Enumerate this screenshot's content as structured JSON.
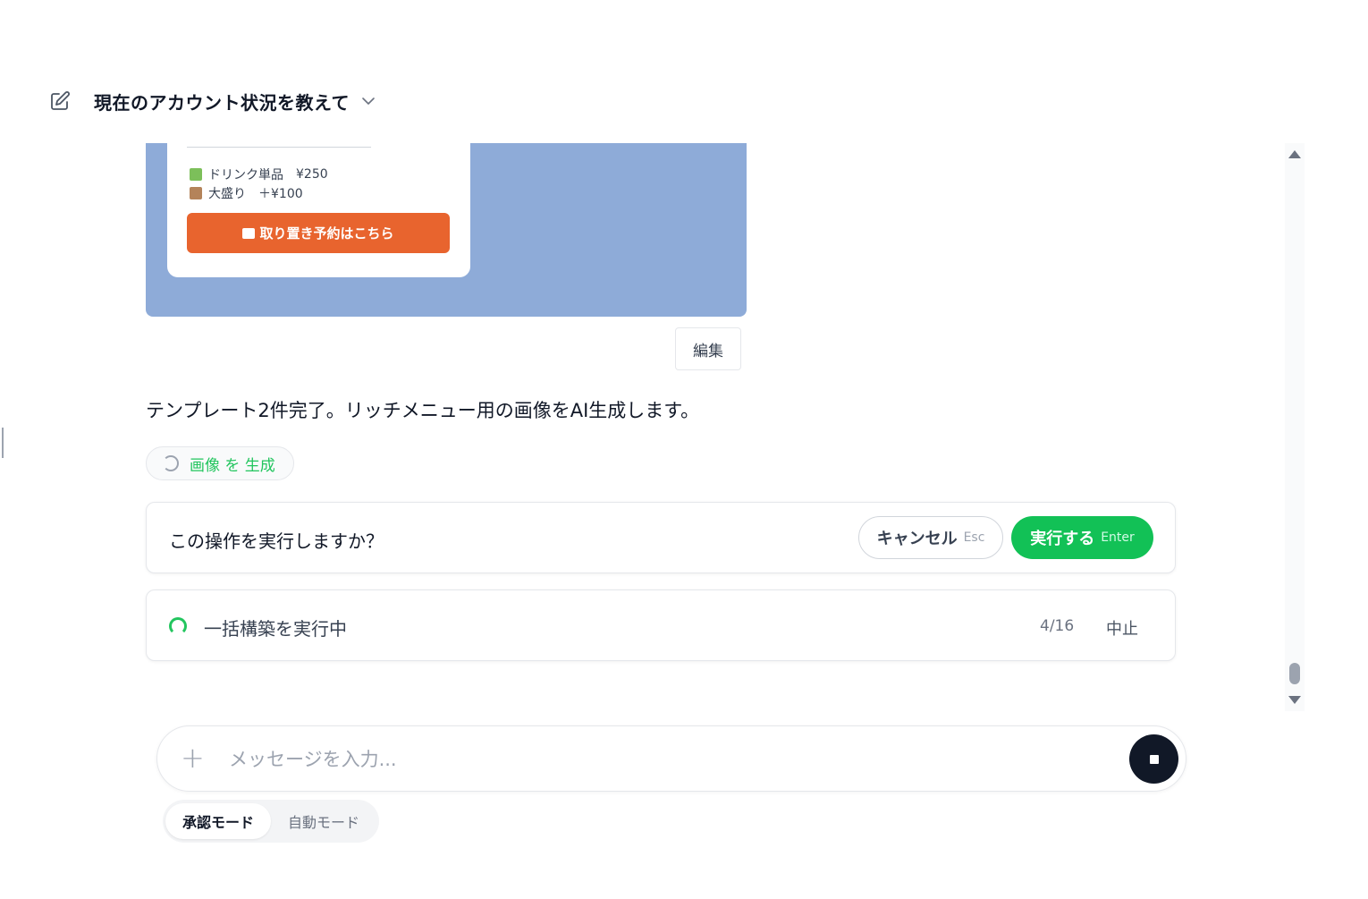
{
  "header": {
    "title": "現在のアカウント状況を教えて",
    "edit_icon": "edit-icon",
    "chevron_icon": "chevron-down-icon"
  },
  "preview_card": {
    "top_text": "¥...",
    "items": [
      {
        "icon": "drink-icon",
        "label": "ドリンク単品",
        "price": "¥250"
      },
      {
        "icon": "box-icon",
        "label": "大盛り",
        "price": "＋¥100"
      }
    ],
    "reserve_button": "取り置き予約はこちら",
    "background_color": "#8eabd8",
    "button_color": "#e8642e"
  },
  "edit_button": "編集",
  "assistant_message": "テンプレート2件完了。リッチメニュー用の画像をAI生成します。",
  "tool_chip": {
    "label": "画像 を 生成",
    "icon": "spinner-icon"
  },
  "confirm": {
    "question": "この操作を実行しますか？",
    "cancel_label": "キャンセル",
    "cancel_key": "Esc",
    "run_label": "実行する",
    "run_key": "Enter",
    "run_color": "#12c156"
  },
  "progress": {
    "label": "一括構築を実行中",
    "count": "4/16",
    "stop_label": "中止"
  },
  "composer": {
    "placeholder": "メッセージを入力...",
    "plus_icon": "plus-icon",
    "stop_icon": "stop-icon"
  },
  "modes": {
    "active": "承認モード",
    "inactive": "自動モード"
  }
}
